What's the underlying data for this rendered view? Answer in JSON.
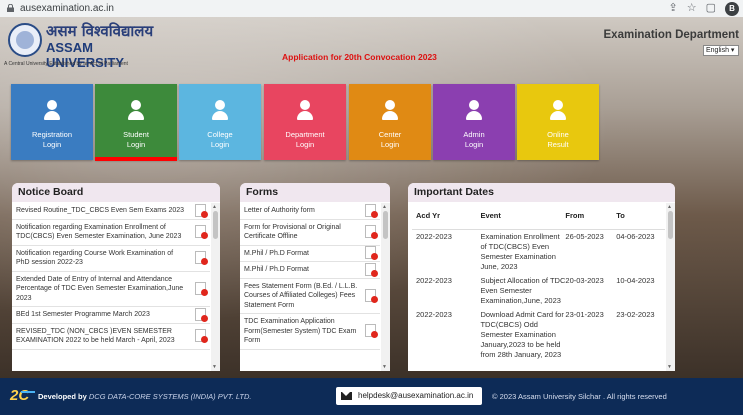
{
  "browser": {
    "url": "ausexamination.ac.in"
  },
  "header": {
    "hindi_name": "असम विश्वविद्यालय",
    "university": "ASSAM UNIVERSITY",
    "tagline": "A Central University Established by an Act of Parliament",
    "application_notice": "Application for 20th Convocation 2023",
    "department": "Examination Department",
    "language": "English"
  },
  "tiles": [
    {
      "line1": "Registration",
      "line2": "Login",
      "color": "#3a7cc1"
    },
    {
      "line1": "Student",
      "line2": "Login",
      "color": "#3d8a3b"
    },
    {
      "line1": "College",
      "line2": "Login",
      "color": "#5cb6e0"
    },
    {
      "line1": "Department",
      "line2": "Login",
      "color": "#e84560"
    },
    {
      "line1": "Center",
      "line2": "Login",
      "color": "#e08a14"
    },
    {
      "line1": "Admin",
      "line2": "Login",
      "color": "#8b3fb0"
    },
    {
      "line1": "Online",
      "line2": "Result",
      "color": "#e8c80e"
    }
  ],
  "notice_board": {
    "title": "Notice Board",
    "items": [
      "Revised Routine_TDC_CBCS Even Sem Exams 2023",
      "Notification regarding Examination Enrollment of TDC(CBCS) Even Semester Examination, June 2023",
      "Notification regarding Course Work Examination of PhD session 2022-23",
      "Extended Date of Entry of Internal and Attendance Percentage of TDC Even Semester Examination,June 2023",
      "BEd 1st Semester Programme March 2023",
      "REVISED_TDC (NON_CBCS )EVEN SEMESTER EXAMINATION 2022 to be held March - April, 2023"
    ]
  },
  "forms": {
    "title": "Forms",
    "items": [
      "Letter of Authority form",
      "Form for Provisional or Original Certificate Offline",
      "M.Phil / Ph.D Format",
      "M.Phil / Ph.D Format",
      "Fees Statement Form (B.Ed. / L.L.B. Courses of Affiliated Colleges) Fees Statement Form",
      "TDC Examination Application Form(Semester System) TDC Exam Form"
    ]
  },
  "important_dates": {
    "title": "Important Dates",
    "columns": [
      "Acd Yr",
      "Event",
      "From",
      "To"
    ],
    "rows": [
      [
        "2022-2023",
        "Examination Enrollment of TDC(CBCS) Even Semester Examination June, 2023",
        "26-05-2023",
        "04-06-2023"
      ],
      [
        "2022-2023",
        "Subject Allocation of TDC Even Semester Examination,June, 2023",
        "20-03-2023",
        "10-04-2023"
      ],
      [
        "2022-2023",
        "Download Admit Card for TDC(CBCS) Odd Semester Examination January,2023 to be held from 28th January, 2023",
        "23-01-2023",
        "23-02-2023"
      ]
    ]
  },
  "footer": {
    "developed_by": "Developed by",
    "company": "DCG DATA-CORE SYSTEMS (INDIA) PVT. LTD.",
    "email": "helpdesk@ausexamination.ac.in",
    "copyright": "© 2023 Assam University Silchar . All rights reserved"
  }
}
